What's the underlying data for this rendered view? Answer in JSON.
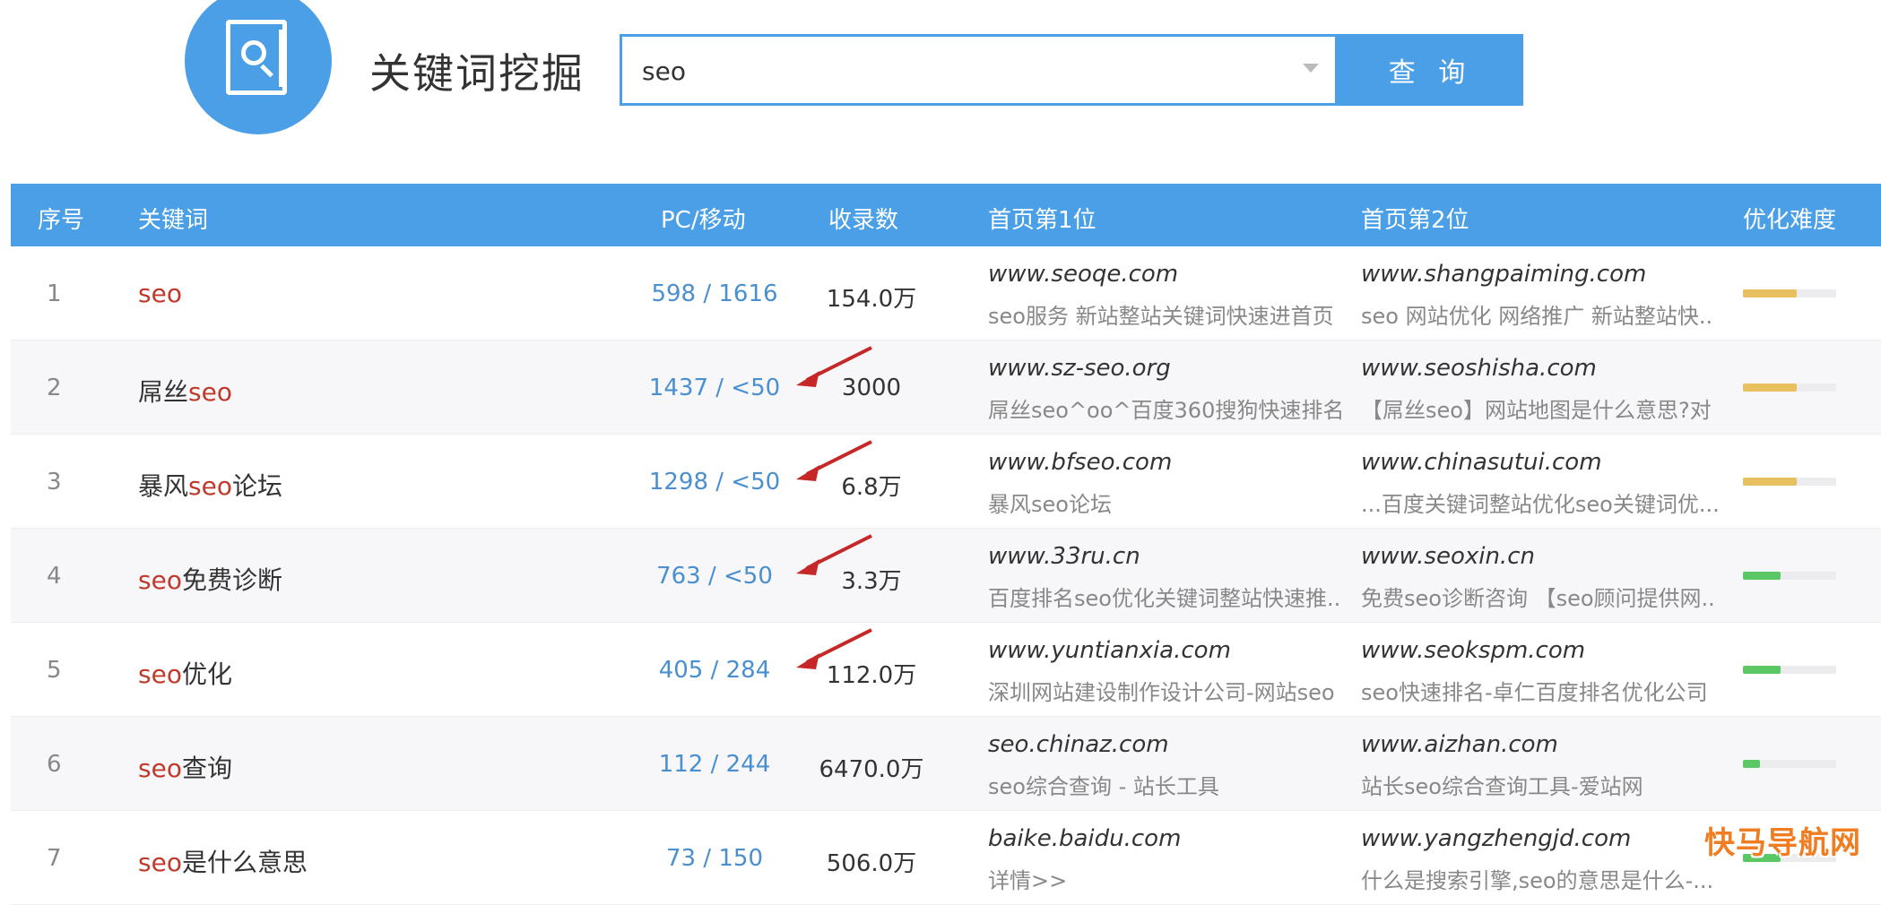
{
  "header": {
    "title": "关键词挖掘",
    "search_value": "seo",
    "search_button": "查 询"
  },
  "table": {
    "columns": [
      "序号",
      "关键词",
      "PC/移动",
      "收录数",
      "首页第1位",
      "首页第2位",
      "优化难度"
    ],
    "rows": [
      {
        "idx": "1",
        "kw_pre": "",
        "kw_hl": "seo",
        "kw_post": "",
        "pc_mobile": "598 / 1616",
        "indexed": "154.0万",
        "rank1_site": "www.seoqe.com",
        "rank1_desc": "seo服务  新站整站关键词快速进首页",
        "rank2_site": "www.shangpaiming.com",
        "rank2_desc": "seo  网站优化  网络推广  新站整站快..",
        "difficulty": 0.58,
        "difficulty_color": "#e8c060",
        "arrow": false
      },
      {
        "idx": "2",
        "kw_pre": "屌丝",
        "kw_hl": "seo",
        "kw_post": "",
        "pc_mobile": "1437 / <50",
        "indexed": "3000",
        "rank1_site": "www.sz-seo.org",
        "rank1_desc": "屌丝seo^oo^百度360搜狗快速排名",
        "rank2_site": "www.seoshisha.com",
        "rank2_desc": "【屌丝seo】网站地图是什么意思?对",
        "difficulty": 0.58,
        "difficulty_color": "#e8c060",
        "arrow": true
      },
      {
        "idx": "3",
        "kw_pre": "暴风",
        "kw_hl": "seo",
        "kw_post": "论坛",
        "pc_mobile": "1298 / <50",
        "indexed": "6.8万",
        "rank1_site": "www.bfseo.com",
        "rank1_desc": "暴风seo论坛",
        "rank2_site": "www.chinasutui.com",
        "rank2_desc": "...百度关键词整站优化seo关键词优...",
        "difficulty": 0.58,
        "difficulty_color": "#e8c060",
        "arrow": true
      },
      {
        "idx": "4",
        "kw_pre": "",
        "kw_hl": "seo",
        "kw_post": "免费诊断",
        "pc_mobile": "763 / <50",
        "indexed": "3.3万",
        "rank1_site": "www.33ru.cn",
        "rank1_desc": "百度排名seo优化关键词整站快速推..",
        "rank2_site": "www.seoxin.cn",
        "rank2_desc": "免费seo诊断咨询  【seo顾问提供网..",
        "difficulty": 0.4,
        "difficulty_color": "#5cc865",
        "arrow": true
      },
      {
        "idx": "5",
        "kw_pre": "",
        "kw_hl": "seo",
        "kw_post": "优化",
        "pc_mobile": "405 / 284",
        "indexed": "112.0万",
        "rank1_site": "www.yuntianxia.com",
        "rank1_desc": "深圳网站建设制作设计公司-网站seo",
        "rank2_site": "www.seokspm.com",
        "rank2_desc": "seo快速排名-卓仁百度排名优化公司",
        "difficulty": 0.4,
        "difficulty_color": "#5cc865",
        "arrow": true
      },
      {
        "idx": "6",
        "kw_pre": "",
        "kw_hl": "seo",
        "kw_post": "查询",
        "pc_mobile": "112 / 244",
        "indexed": "6470.0万",
        "rank1_site": "seo.chinaz.com",
        "rank1_desc": "seo综合查询 - 站长工具",
        "rank2_site": "www.aizhan.com",
        "rank2_desc": "站长seo综合查询工具-爱站网",
        "difficulty": 0.18,
        "difficulty_color": "#5cc865",
        "arrow": false
      },
      {
        "idx": "7",
        "kw_pre": "",
        "kw_hl": "seo",
        "kw_post": "是什么意思",
        "pc_mobile": "73 / 150",
        "indexed": "506.0万",
        "rank1_site": "baike.baidu.com",
        "rank1_desc": "详情>>",
        "rank2_site": "www.yangzhengjd.com",
        "rank2_desc": "什么是搜索引擎,seo的意思是什么-...",
        "difficulty": 0.4,
        "difficulty_color": "#5cc865",
        "arrow": false
      }
    ]
  },
  "watermark": "快马导航网",
  "colors": {
    "accent": "#4a9fe6",
    "keyword_highlight": "#c0392b",
    "arrow": "#c62828"
  }
}
